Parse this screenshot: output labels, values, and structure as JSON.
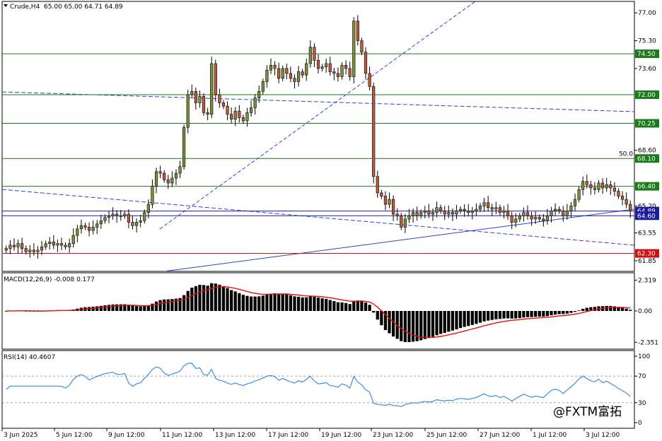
{
  "header": {
    "symbol": "Crude,H4",
    "ohlc": "65.00 65.00 64.71 64.89"
  },
  "colors": {
    "bull": "#7a8f3a",
    "bear": "#c05a3a",
    "level_green": "#1b7a1b",
    "level_red": "#d01010",
    "level_blue": "#1c1ca0",
    "trend_blue": "#3040d0",
    "macd_signal": "#e01010",
    "rsi_line": "#3b8fe0",
    "grid": "#000000"
  },
  "watermark": "@FXTM富拓",
  "fib_label": "50.0",
  "chart_data": [
    {
      "type": "candlestick",
      "title": "Crude,H4",
      "ylim": [
        61.2,
        77.7
      ],
      "y_ticks": [
        "77.00",
        "75.30",
        "73.60",
        "68.60",
        "65.20",
        "63.55",
        "61.85"
      ],
      "levels": [
        {
          "value": 74.5,
          "label": "74.50",
          "color": "green"
        },
        {
          "value": 72.0,
          "label": "72.00",
          "color": "green"
        },
        {
          "value": 70.25,
          "label": "70.25",
          "color": "green"
        },
        {
          "value": 68.1,
          "label": "68.10",
          "color": "green"
        },
        {
          "value": 66.4,
          "label": "66.40",
          "color": "green"
        },
        {
          "value": 64.89,
          "label": "64.89",
          "color": "blue"
        },
        {
          "value": 64.6,
          "label": "64.60",
          "color": "blue"
        },
        {
          "value": 62.3,
          "label": "62.30",
          "color": "red"
        }
      ],
      "x_labels": [
        "3 Jun 2025",
        "5 Jun 12:00",
        "9 Jun 12:00",
        "11 Jun 12:00",
        "13 Jun 12:00",
        "17 Jun 12:00",
        "19 Jun 12:00",
        "23 Jun 12:00",
        "25 Jun 12:00",
        "27 Jun 12:00",
        "1 Jul 12:00",
        "3 Jul 12:00"
      ],
      "closes": [
        62.6,
        62.8,
        62.7,
        62.9,
        62.6,
        62.4,
        62.5,
        62.4,
        62.5,
        62.7,
        62.9,
        63.0,
        62.8,
        62.9,
        62.8,
        62.7,
        62.9,
        63.4,
        63.8,
        64.0,
        63.9,
        63.7,
        63.9,
        64.1,
        64.3,
        64.5,
        64.6,
        64.7,
        64.6,
        64.6,
        64.7,
        64.2,
        64.0,
        64.2,
        64.3,
        64.8,
        65.3,
        66.4,
        67.3,
        67.2,
        66.8,
        66.6,
        66.9,
        67.2,
        67.6,
        70.0,
        72.0,
        72.2,
        71.5,
        71.9,
        70.9,
        70.8,
        73.9,
        72.0,
        71.5,
        71.3,
        70.8,
        70.5,
        71.0,
        70.6,
        70.4,
        70.9,
        71.2,
        71.8,
        72.2,
        72.8,
        73.5,
        73.8,
        73.6,
        73.0,
        73.6,
        73.3,
        73.0,
        72.8,
        73.4,
        73.2,
        73.9,
        74.9,
        74.1,
        73.6,
        73.7,
        73.9,
        73.4,
        73.3,
        73.1,
        73.8,
        73.6,
        73.1,
        76.5,
        75.3,
        74.6,
        73.3,
        72.5,
        67.0,
        66.0,
        65.8,
        65.3,
        65.6,
        64.7,
        64.6,
        63.9,
        64.4,
        64.6,
        64.8,
        64.6,
        64.8,
        64.9,
        64.7,
        64.8,
        65.1,
        64.9,
        64.7,
        64.8,
        64.7,
        64.9,
        65.0,
        64.9,
        64.8,
        64.9,
        65.0,
        65.2,
        65.4,
        65.1,
        65.0,
        65.1,
        64.8,
        64.9,
        64.6,
        64.2,
        64.4,
        64.6,
        64.8,
        64.6,
        64.4,
        64.5,
        64.4,
        64.3,
        64.6,
        64.9,
        65.0,
        64.9,
        64.6,
        64.9,
        65.2,
        65.6,
        66.2,
        66.7,
        66.5,
        66.3,
        66.2,
        66.6,
        66.3,
        66.5,
        66.3,
        66.1,
        65.8,
        65.6,
        65.3,
        64.89
      ]
    },
    {
      "type": "bar",
      "title": "MACD(12,26,9) -0.008 0.177",
      "ylim": [
        -2.55,
        2.55
      ],
      "y_ticks": [
        "2.319",
        "0.00",
        "-2.351"
      ],
      "series": [
        {
          "name": "MACD",
          "values": "computed from closes (EMA12 − EMA26)"
        },
        {
          "name": "Signal",
          "values": "EMA9 of MACD"
        }
      ]
    },
    {
      "type": "line",
      "title": "RSI(14) 40.4607",
      "ylim": [
        0,
        100
      ],
      "y_ticks": [
        "100",
        "70",
        "30",
        "0"
      ],
      "series": [
        {
          "name": "RSI(14)",
          "values": "computed from closes"
        }
      ]
    }
  ]
}
